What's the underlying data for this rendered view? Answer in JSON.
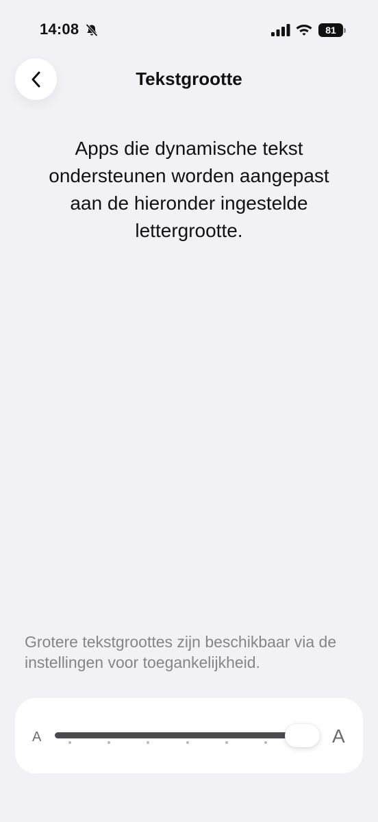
{
  "status_bar": {
    "time": "14:08",
    "silent_icon": "bell-slash-icon",
    "signal_icon": "cellular-signal-icon",
    "wifi_icon": "wifi-icon",
    "battery_level": "81"
  },
  "nav": {
    "back_icon": "chevron-left-icon",
    "title": "Tekstgrootte"
  },
  "description": "Apps die dynamische tekst ondersteunen worden aangepast aan de hieronder ingestelde lettergrootte.",
  "footnote": "Grotere tekstgroottes zijn beschikbaar via de instellingen voor toegankelijkheid.",
  "slider": {
    "min_label": "A",
    "max_label": "A",
    "steps": 7,
    "selected_step": 7
  },
  "colors": {
    "background": "#f2f1f6",
    "card": "#ffffff",
    "track": "#4a4a4f",
    "secondary_text": "#858589"
  }
}
